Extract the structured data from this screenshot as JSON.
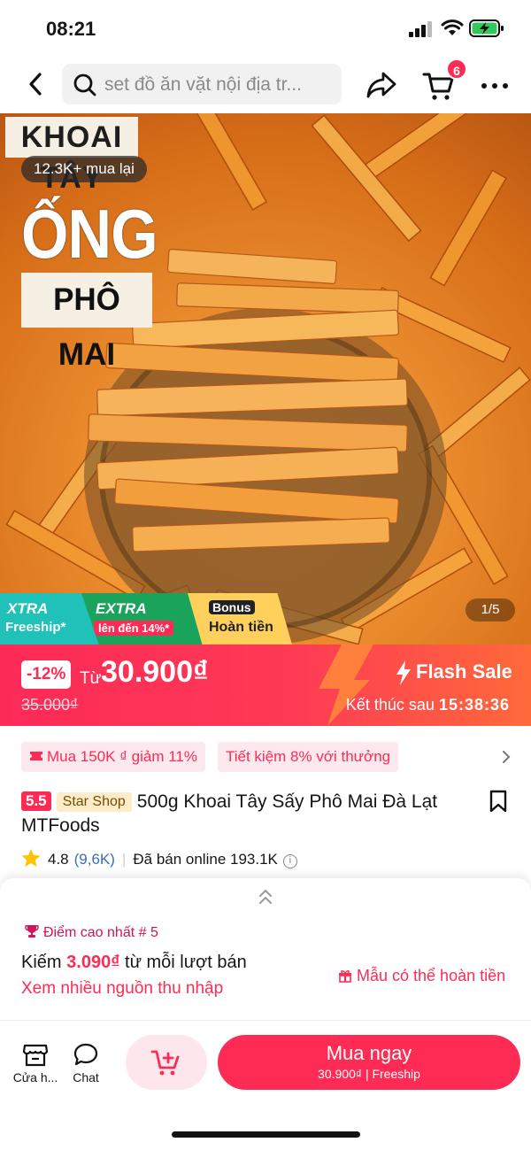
{
  "status_bar": {
    "time": "08:21"
  },
  "header": {
    "search_text": "set đồ ăn vặt nội địa tr...",
    "cart_count": "6"
  },
  "hero": {
    "brand_top": "KHOAI TÂY",
    "rebuy": "12.3K+ mua lại",
    "headline": "ỐNG",
    "headline2": "PHÔ MAI",
    "counter": "1/5",
    "banners": {
      "xtra1_title": "XTRA",
      "xtra1_sub": "Freeship*",
      "xtra2_title": "EXTRA",
      "xtra2_sub": "lên đến 14%*",
      "bonus_title": "Bonus",
      "bonus_sub": "Hoàn tiền"
    }
  },
  "flash": {
    "discount": "-12%",
    "from": "Từ",
    "price": "30.900₫",
    "old_price": "35.000₫",
    "label": "Flash Sale",
    "ends_prefix": "Kết thúc sau",
    "countdown": "15:38:36"
  },
  "vouchers": [
    "Mua 150K ₫ giảm 11%",
    "Tiết kiệm 8% với thưởng"
  ],
  "product": {
    "badge": "5.5",
    "shop_tag": "Star Shop",
    "title": "500g Khoai Tây Sấy Phô Mai Đà Lạt MTFoods",
    "rating": "4.8",
    "rating_count": "(9,6K)",
    "sold": "Đã bán online 193.1K"
  },
  "affiliate": {
    "rank": "Điểm cao nhất # 5",
    "earn_prefix": "Kiếm",
    "earn_amount": "3.090₫",
    "earn_suffix": "từ mỗi lượt bán",
    "more_income": "Xem nhiều nguồn thu nhập",
    "refundable": "Mẫu có thể hoàn tiền"
  },
  "bottom_bar": {
    "shop": "Cửa h...",
    "chat": "Chat",
    "buy_now": "Mua ngay",
    "buy_sub": "30.900₫ | Freeship"
  },
  "colors": {
    "accent": "#fe2c55",
    "flash_gradient_end": "#ff6a3a"
  }
}
